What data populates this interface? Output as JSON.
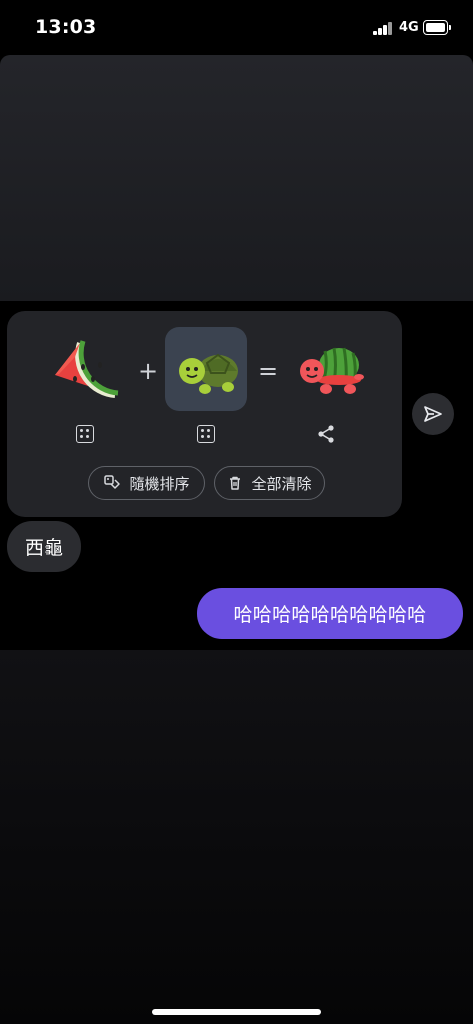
{
  "status_bar": {
    "time": "13:03",
    "network": "4G"
  },
  "emoji_kitchen": {
    "plus_sign": "+",
    "equals_sign": "=",
    "left_emoji": "watermelon",
    "right_emoji": "turtle",
    "result_emoji": "watermelon-turtle",
    "shuffle_label": "隨機排序",
    "clear_label": "全部清除"
  },
  "messages": [
    {
      "from": "other",
      "text": "西龜"
    },
    {
      "from": "me",
      "text": "哈哈哈哈哈哈哈哈哈哈"
    }
  ],
  "colors": {
    "accent": "#6a4fe0",
    "card": "#232428",
    "background": "#000000"
  }
}
